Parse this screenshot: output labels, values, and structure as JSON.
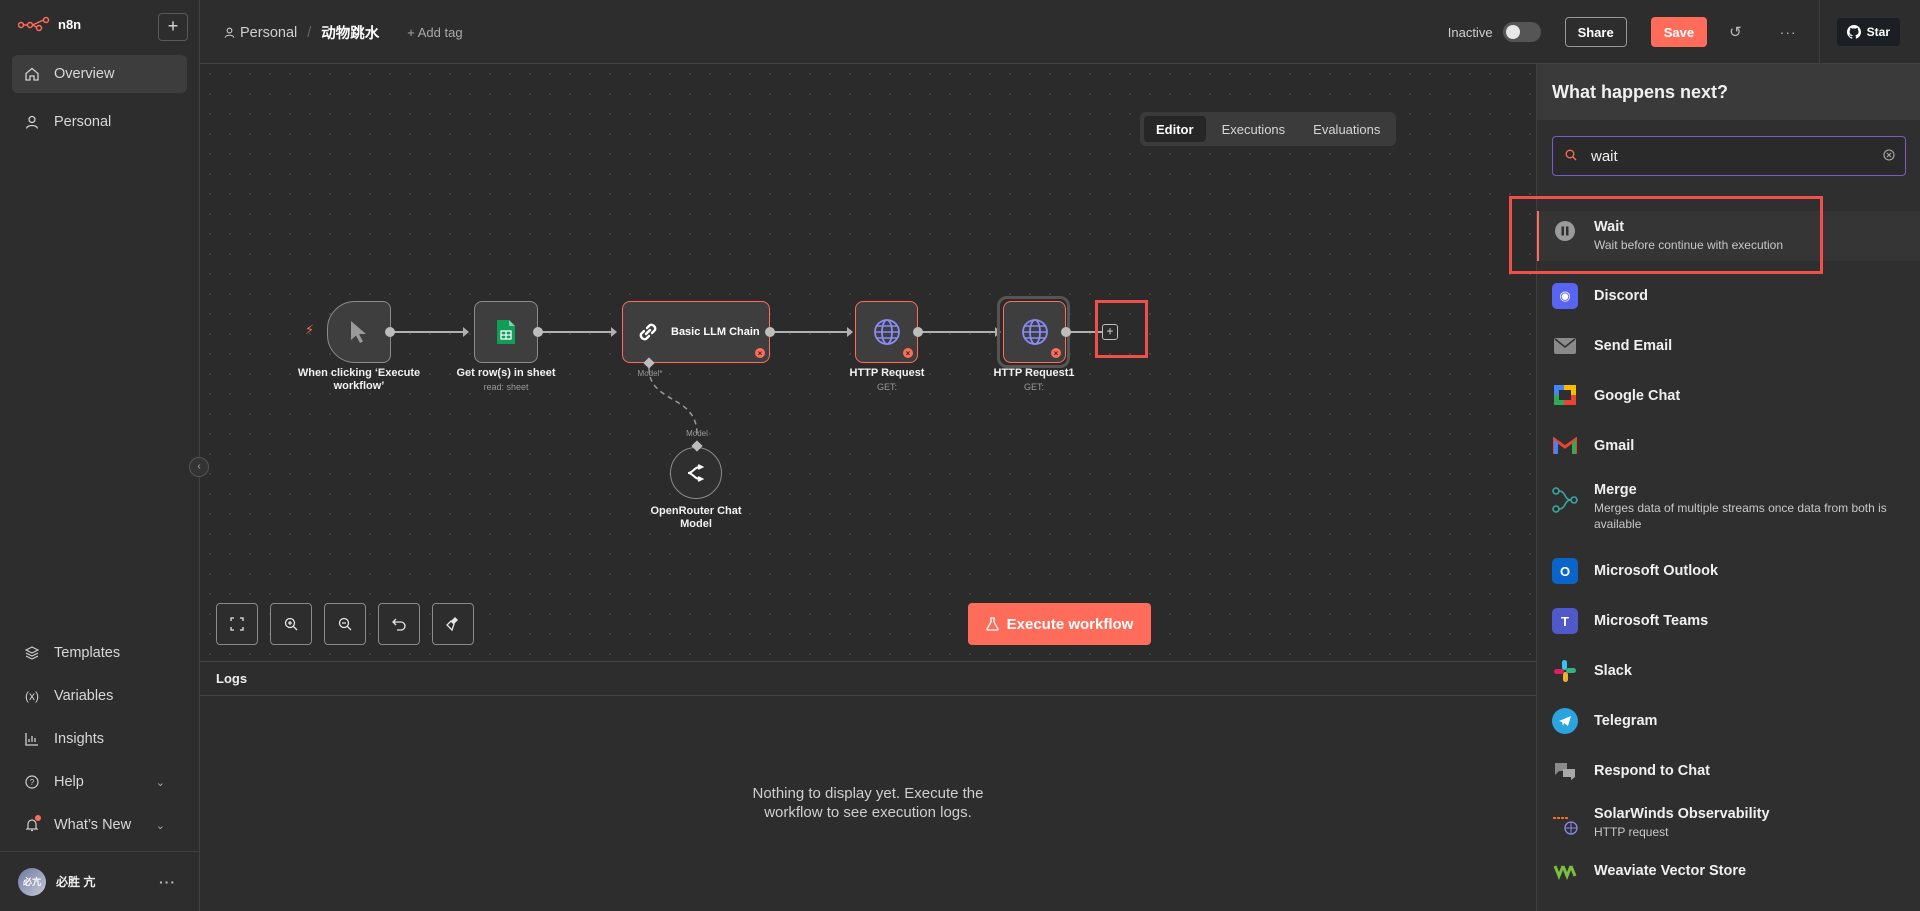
{
  "app": {
    "name": "n8n"
  },
  "sidebar": {
    "new_button": "+",
    "top_items": [
      {
        "label": "Overview",
        "icon": "home-icon"
      },
      {
        "label": "Personal",
        "icon": "user-icon"
      }
    ],
    "bottom_items": [
      {
        "label": "Templates",
        "icon": "templates-icon"
      },
      {
        "label": "Variables",
        "icon": "variables-icon"
      },
      {
        "label": "Insights",
        "icon": "insights-icon"
      },
      {
        "label": "Help",
        "icon": "help-icon"
      },
      {
        "label": "What’s New",
        "icon": "bell-icon"
      }
    ],
    "user": {
      "name": "必胜 亢",
      "avatar_text": "必亢"
    }
  },
  "header": {
    "project": "Personal",
    "workflow_name": "动物跳水",
    "add_tag": "+ Add tag",
    "status": "Inactive",
    "share": "Share",
    "save": "Save",
    "star": "Star"
  },
  "tabs": [
    "Editor",
    "Executions",
    "Evaluations"
  ],
  "nodes": {
    "trigger": {
      "label": "When clicking ‘Execute workflow’"
    },
    "sheet": {
      "label": "Get row(s) in sheet",
      "sub": "read: sheet"
    },
    "llm": {
      "label": "Basic LLM Chain",
      "port": "Model*"
    },
    "http1": {
      "label": "HTTP Request",
      "sub": "GET:"
    },
    "http2": {
      "label": "HTTP Request1",
      "sub": "GET:"
    },
    "model": {
      "label": "OpenRouter Chat Model",
      "port": "Model"
    }
  },
  "execute_button": "Execute workflow",
  "logs": {
    "title": "Logs",
    "empty_line1": "Nothing to display yet. Execute the",
    "empty_line2": "workflow to see execution logs."
  },
  "panel": {
    "title": "What happens next?",
    "search_value": "wait",
    "items": [
      {
        "title": "Wait",
        "desc": "Wait before continue with execution",
        "color": "#9a9a9a"
      },
      {
        "title": "Discord",
        "desc": "",
        "color": "#5865f2"
      },
      {
        "title": "Send Email",
        "desc": "",
        "color": "#8a8a8a"
      },
      {
        "title": "Google Chat",
        "desc": "",
        "color": "#34a853"
      },
      {
        "title": "Gmail",
        "desc": "",
        "color": "#ea4335"
      },
      {
        "title": "Merge",
        "desc": "Merges data of multiple streams once data from both is available",
        "color": "#3aa6a0"
      },
      {
        "title": "Microsoft Outlook",
        "desc": "",
        "color": "#0a64c9"
      },
      {
        "title": "Microsoft Teams",
        "desc": "",
        "color": "#5059c9"
      },
      {
        "title": "Slack",
        "desc": "",
        "color": "#e01e5a"
      },
      {
        "title": "Telegram",
        "desc": "",
        "color": "#2aa3df"
      },
      {
        "title": "Respond to Chat",
        "desc": "",
        "color": "#8a8a8a"
      },
      {
        "title": "SolarWinds Observability",
        "desc": "HTTP request",
        "color": "#f26b21"
      },
      {
        "title": "Weaviate Vector Store",
        "desc": "",
        "color": "#7bbf3e"
      }
    ]
  }
}
